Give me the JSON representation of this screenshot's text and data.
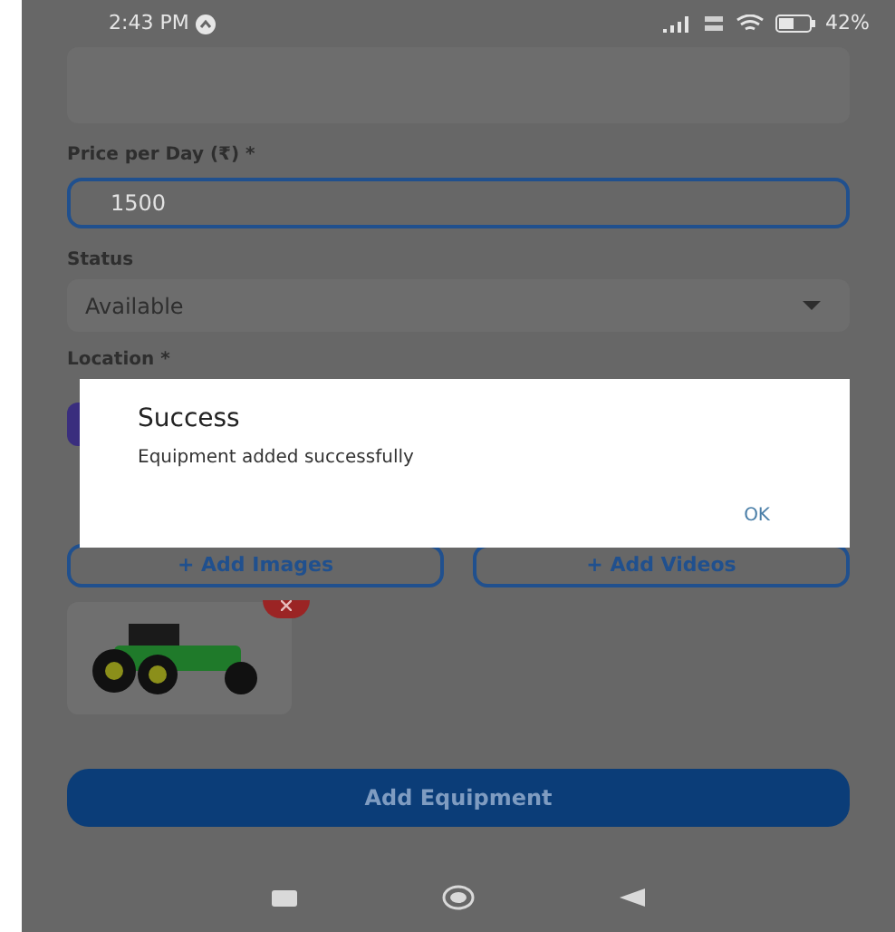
{
  "status_bar": {
    "time": "2:43 PM",
    "battery": "42%"
  },
  "price": {
    "label": "Price per Day (₹) *",
    "value": "1500"
  },
  "status": {
    "label": "Status",
    "value": "Available"
  },
  "location": {
    "label": "Location *"
  },
  "media_buttons": [
    "+ Add Images",
    "+ Add Videos"
  ],
  "submit_button": "Add Equipment",
  "dialog": {
    "title": "Success",
    "message": "Equipment added successfully",
    "button": "OK"
  }
}
